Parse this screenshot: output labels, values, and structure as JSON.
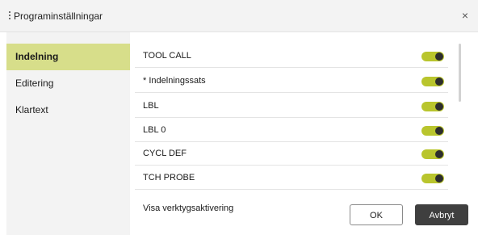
{
  "window": {
    "title": "Programinställningar",
    "close_glyph": "×"
  },
  "sidebar": {
    "items": [
      {
        "label": "Indelning",
        "active": true
      },
      {
        "label": "Editering",
        "active": false
      },
      {
        "label": "Klartext",
        "active": false
      }
    ]
  },
  "settings": {
    "rows": [
      {
        "label": "TOOL CALL",
        "enabled": true
      },
      {
        "label": "* Indelningssats",
        "enabled": true
      },
      {
        "label": "LBL",
        "enabled": true
      },
      {
        "label": "LBL 0",
        "enabled": true
      },
      {
        "label": "CYCL DEF",
        "enabled": true
      },
      {
        "label": "TCH PROBE",
        "enabled": true
      }
    ],
    "footer_label": "Visa verktygsaktivering"
  },
  "buttons": {
    "ok": "OK",
    "cancel": "Avbryt"
  },
  "colors": {
    "accent": "#b9c52d",
    "sidebar_active": "#d7de8a",
    "dark_button": "#3f3f3f"
  }
}
